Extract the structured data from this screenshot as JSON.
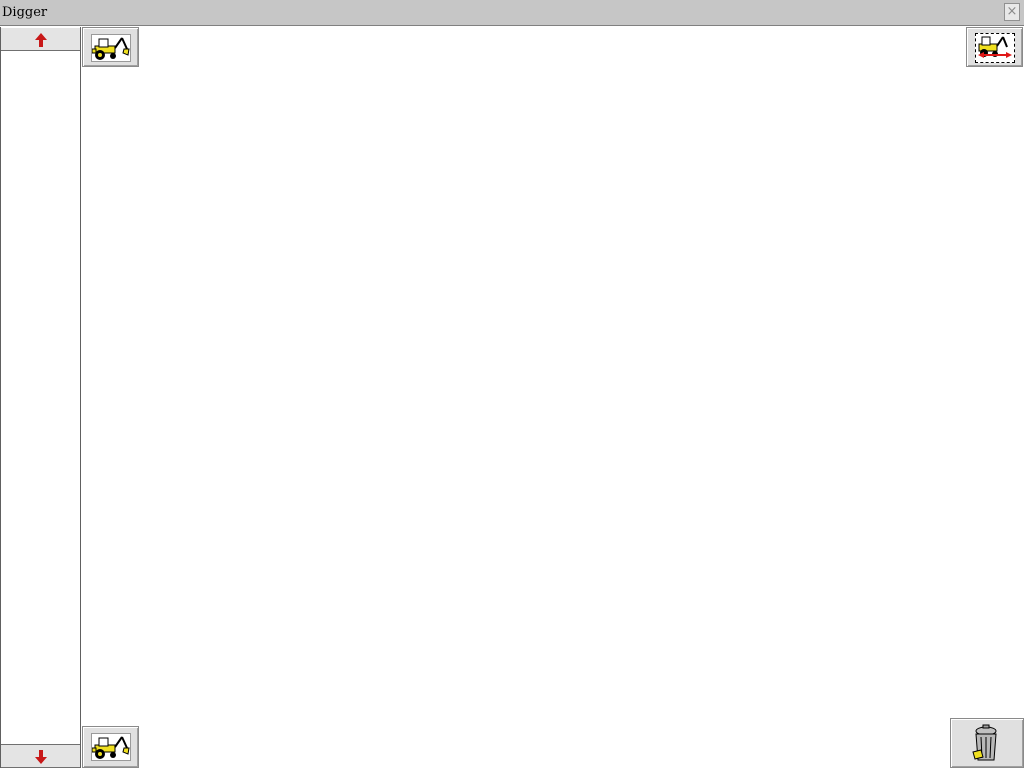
{
  "window": {
    "title": "Digger",
    "close_label": "×"
  },
  "sidebar": {
    "scroll_up_icon": "arrow-up-icon",
    "scroll_down_icon": "arrow-down-icon",
    "arrow_color": "#c81818"
  },
  "tools": {
    "top_left": {
      "icon": "digger-icon"
    },
    "bottom_left": {
      "icon": "digger-icon"
    },
    "top_right": {
      "icon": "digger-selection-icon"
    },
    "bottom_right": {
      "icon": "trash-can-icon"
    }
  },
  "colors": {
    "titlebar": "#c6c6c6",
    "digger_yellow": "#f0e020",
    "selection_red": "#e01818"
  }
}
